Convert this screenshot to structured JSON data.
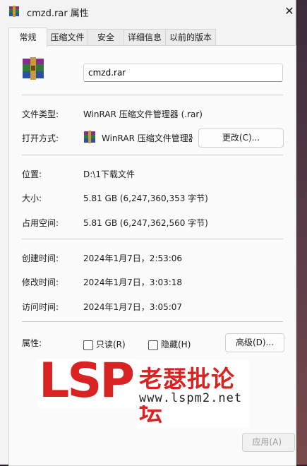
{
  "window": {
    "title": "cmzd.rar 属性",
    "close_glyph": "✕"
  },
  "tabs": [
    "常规",
    "压缩文件",
    "安全",
    "详细信息",
    "以前的版本"
  ],
  "general": {
    "file_name": "cmzd.rar",
    "type_label": "文件类型:",
    "type_value": "WinRAR 压缩文件管理器 (.rar)",
    "open_with_label": "打开方式:",
    "open_with_value": "WinRAR 压缩文件管理器",
    "change_button": "更改(C)...",
    "location_label": "位置:",
    "location_value": "D:\\1下载文件",
    "size_label": "大小:",
    "size_value": "5.81 GB (6,247,360,353 字节)",
    "size_on_disk_label": "占用空间:",
    "size_on_disk_value": "5.81 GB (6,247,362,560 字节)",
    "created_label": "创建时间:",
    "created_value": "2024年1月7日，2:53:06",
    "modified_label": "修改时间:",
    "modified_value": "2024年1月7日，3:03:18",
    "accessed_label": "访问时间:",
    "accessed_value": "2024年1月7日，3:05:07",
    "attributes_label": "属性:",
    "readonly_label": "只读(R)",
    "hidden_label": "隐藏(H)",
    "advanced_button": "高级(D)..."
  },
  "footer": {
    "apply_button": "应用(A)"
  },
  "watermark": {
    "logo": "LSP",
    "site_name": "老瑟批论坛",
    "url": "www.lspm2.net"
  }
}
